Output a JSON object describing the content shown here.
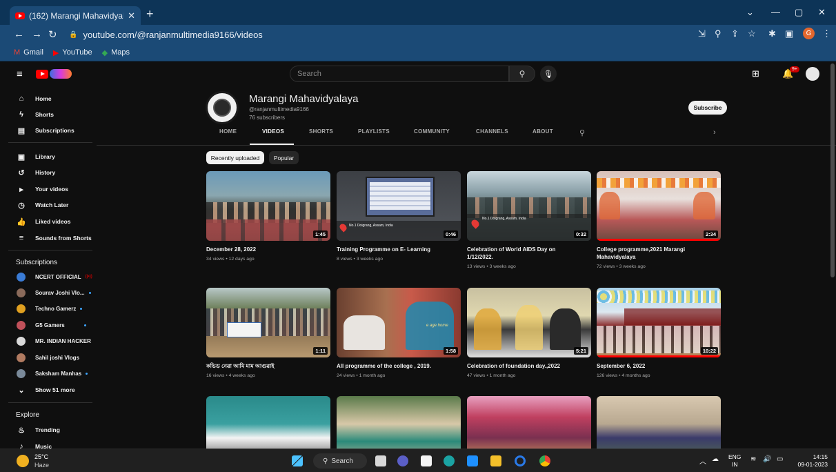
{
  "browser": {
    "tab_title": "(162) Marangi Mahavidyalaya - Y",
    "tab_close": "✕",
    "new_tab": "+",
    "url": "youtube.com/@ranjanmultimedia9166/videos",
    "profile_initial": "G",
    "window_controls": [
      "⌄",
      "—",
      "▢",
      "✕"
    ],
    "bookmarks": [
      {
        "label": "Gmail",
        "icon": "gmail-icon"
      },
      {
        "label": "YouTube",
        "icon": "youtube-icon"
      },
      {
        "label": "Maps",
        "icon": "maps-icon"
      }
    ]
  },
  "masthead": {
    "search_placeholder": "Search",
    "notification_count": "9+"
  },
  "sidebar": {
    "main": [
      {
        "label": "Home",
        "icon": "⌂"
      },
      {
        "label": "Shorts",
        "icon": "ϟ"
      },
      {
        "label": "Subscriptions",
        "icon": "▤"
      }
    ],
    "library": [
      {
        "label": "Library",
        "icon": "▣"
      },
      {
        "label": "History",
        "icon": "↺"
      },
      {
        "label": "Your videos",
        "icon": "▸"
      },
      {
        "label": "Watch Later",
        "icon": "◷"
      },
      {
        "label": "Liked videos",
        "icon": "👍"
      },
      {
        "label": "Sounds from Shorts",
        "icon": "≡"
      }
    ],
    "subscriptions_heading": "Subscriptions",
    "subscriptions": [
      {
        "label": "NCERT OFFICIAL",
        "color": "#3a7bd5",
        "status": "live"
      },
      {
        "label": "Sourav Joshi Vlo...",
        "color": "#8a6a5a",
        "status": "dot"
      },
      {
        "label": "Techno Gamerz",
        "color": "#e0a020",
        "status": "dot"
      },
      {
        "label": "G5 Gamers",
        "color": "#c0505a",
        "status": "dot"
      },
      {
        "label": "MR. INDIAN HACKER",
        "color": "#d9d9d9",
        "status": ""
      },
      {
        "label": "Sahil joshi Vlogs",
        "color": "#b07a60",
        "status": ""
      },
      {
        "label": "Saksham Manhas",
        "color": "#7a8a9a",
        "status": "dot"
      }
    ],
    "show_more": "Show 51 more",
    "live_label": "((•))",
    "explore_heading": "Explore",
    "explore": [
      {
        "label": "Trending",
        "icon": "♨"
      },
      {
        "label": "Music",
        "icon": "♪"
      }
    ]
  },
  "channel": {
    "name": "Marangi Mahavidyalaya",
    "handle": "@ranjanmultimedia9166",
    "subscribers": "76 subscribers",
    "subscribe_label": "Subscribe",
    "tabs": [
      "HOME",
      "VIDEOS",
      "SHORTS",
      "PLAYLISTS",
      "COMMUNITY",
      "CHANNELS",
      "ABOUT"
    ],
    "active_tab": "VIDEOS"
  },
  "chips": {
    "recent": "Recently uploaded",
    "popular": "Popular"
  },
  "videos": [
    {
      "title": "December 28, 2022",
      "title2": "",
      "meta": "34 views • 12 days ago",
      "duration": "1:45",
      "progress": 0
    },
    {
      "title": "Training Programme on E- Learning",
      "title2": "",
      "meta": "8 views • 3 weeks ago",
      "duration": "0:46",
      "progress": 0
    },
    {
      "title": "Celebration of World AIDS Day on",
      "title2": "1/12/2022.",
      "meta": "13 views • 3 weeks ago",
      "duration": "0:32",
      "progress": 0
    },
    {
      "title": "College programme,2021 Marangi",
      "title2": "Mahavidyalaya",
      "meta": "72 views • 3 weeks ago",
      "duration": "2:34",
      "progress": 1
    },
    {
      "title": "কভিড নেৱা আমি মাম আগুৱাই",
      "title2": "",
      "meta": "16 views • 4 weeks ago",
      "duration": "1:11",
      "progress": 0
    },
    {
      "title": "All programme of the college , 2019.",
      "title2": "",
      "meta": "24 views • 1 month ago",
      "duration": "1:58",
      "progress": 0
    },
    {
      "title": "Celebration of foundation day.,2022",
      "title2": "",
      "meta": "47 views • 1 month ago",
      "duration": "5:21",
      "progress": 0
    },
    {
      "title": "September 6, 2022",
      "title2": "",
      "meta": "126 views • 4 months ago",
      "duration": "10:22",
      "progress": 1
    },
    {
      "title": "",
      "title2": "",
      "meta": "",
      "duration": "",
      "progress": 0
    },
    {
      "title": "",
      "title2": "",
      "meta": "",
      "duration": "",
      "progress": 0
    },
    {
      "title": "",
      "title2": "",
      "meta": "",
      "duration": "",
      "progress": 0
    },
    {
      "title": "",
      "title2": "",
      "meta": "",
      "duration": "",
      "progress": 0
    }
  ],
  "thumb_text": {
    "t2_caption": "No.1 Doigrang, Assam, India",
    "t3_caption": "No.1 Doigrang, Assam, India",
    "t6_overlay": "e age home"
  },
  "taskbar": {
    "temp": "25°C",
    "weather": "Haze",
    "search": "Search",
    "lang1": "ENG",
    "lang2": "IN",
    "time": "14:15",
    "date": "09-01-2023"
  }
}
